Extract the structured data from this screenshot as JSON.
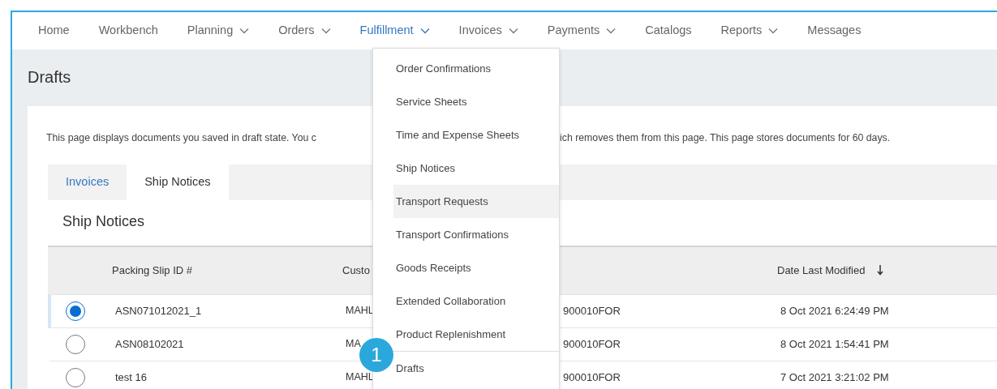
{
  "nav": [
    {
      "label": "Home",
      "dropdown": false,
      "selected": false
    },
    {
      "label": "Workbench",
      "dropdown": false,
      "selected": false
    },
    {
      "label": "Planning",
      "dropdown": true,
      "selected": false
    },
    {
      "label": "Orders",
      "dropdown": true,
      "selected": false
    },
    {
      "label": "Fulfillment",
      "dropdown": true,
      "selected": true
    },
    {
      "label": "Invoices",
      "dropdown": true,
      "selected": false
    },
    {
      "label": "Payments",
      "dropdown": true,
      "selected": false
    },
    {
      "label": "Catalogs",
      "dropdown": false,
      "selected": false
    },
    {
      "label": "Reports",
      "dropdown": true,
      "selected": false
    },
    {
      "label": "Messages",
      "dropdown": false,
      "selected": false
    }
  ],
  "page_title": "Drafts",
  "description": {
    "before": "This page displays documents you saved in draft state. You c",
    "after": "ich removes them from this page. This page stores documents for 60 days."
  },
  "tabs": [
    {
      "label": "Invoices",
      "selected": false
    },
    {
      "label": "Ship Notices",
      "selected": true
    }
  ],
  "section_title": "Ship Notices",
  "table": {
    "columns": [
      {
        "label": "Packing Slip ID #",
        "sorted": false
      },
      {
        "label": "Custo",
        "sorted": false
      },
      {
        "label": "Date Last Modified",
        "sorted": true
      }
    ],
    "rows": [
      {
        "selected": true,
        "packing_slip_id": "ASN071012021_1",
        "customer_start": "MAHL",
        "customer_end": "900010FOR",
        "date_last_modified": "8 Oct 2021 6:24:49 PM"
      },
      {
        "selected": false,
        "packing_slip_id": "ASN08102021",
        "customer_start": "MA",
        "customer_end": "900010FOR",
        "date_last_modified": "8 Oct 2021 1:54:41 PM"
      },
      {
        "selected": false,
        "packing_slip_id": "test 16",
        "customer_start": "MAHL",
        "customer_end": "900010FOR",
        "date_last_modified": "7 Oct 2021 3:21:02 PM"
      }
    ]
  },
  "dropdown": {
    "items": [
      {
        "label": "Order Confirmations",
        "highlighted": false,
        "divider_before": false
      },
      {
        "label": "Service Sheets",
        "highlighted": false,
        "divider_before": false
      },
      {
        "label": "Time and Expense Sheets",
        "highlighted": false,
        "divider_before": false
      },
      {
        "label": "Ship Notices",
        "highlighted": false,
        "divider_before": false
      },
      {
        "label": "Transport Requests",
        "highlighted": true,
        "divider_before": false
      },
      {
        "label": "Transport Confirmations",
        "highlighted": false,
        "divider_before": false
      },
      {
        "label": "Goods Receipts",
        "highlighted": false,
        "divider_before": false
      },
      {
        "label": "Extended Collaboration",
        "highlighted": false,
        "divider_before": false
      },
      {
        "label": "Product Replenishment",
        "highlighted": false,
        "divider_before": false
      },
      {
        "label": "Drafts",
        "highlighted": false,
        "divider_before": true
      }
    ]
  },
  "step_badge": "1"
}
